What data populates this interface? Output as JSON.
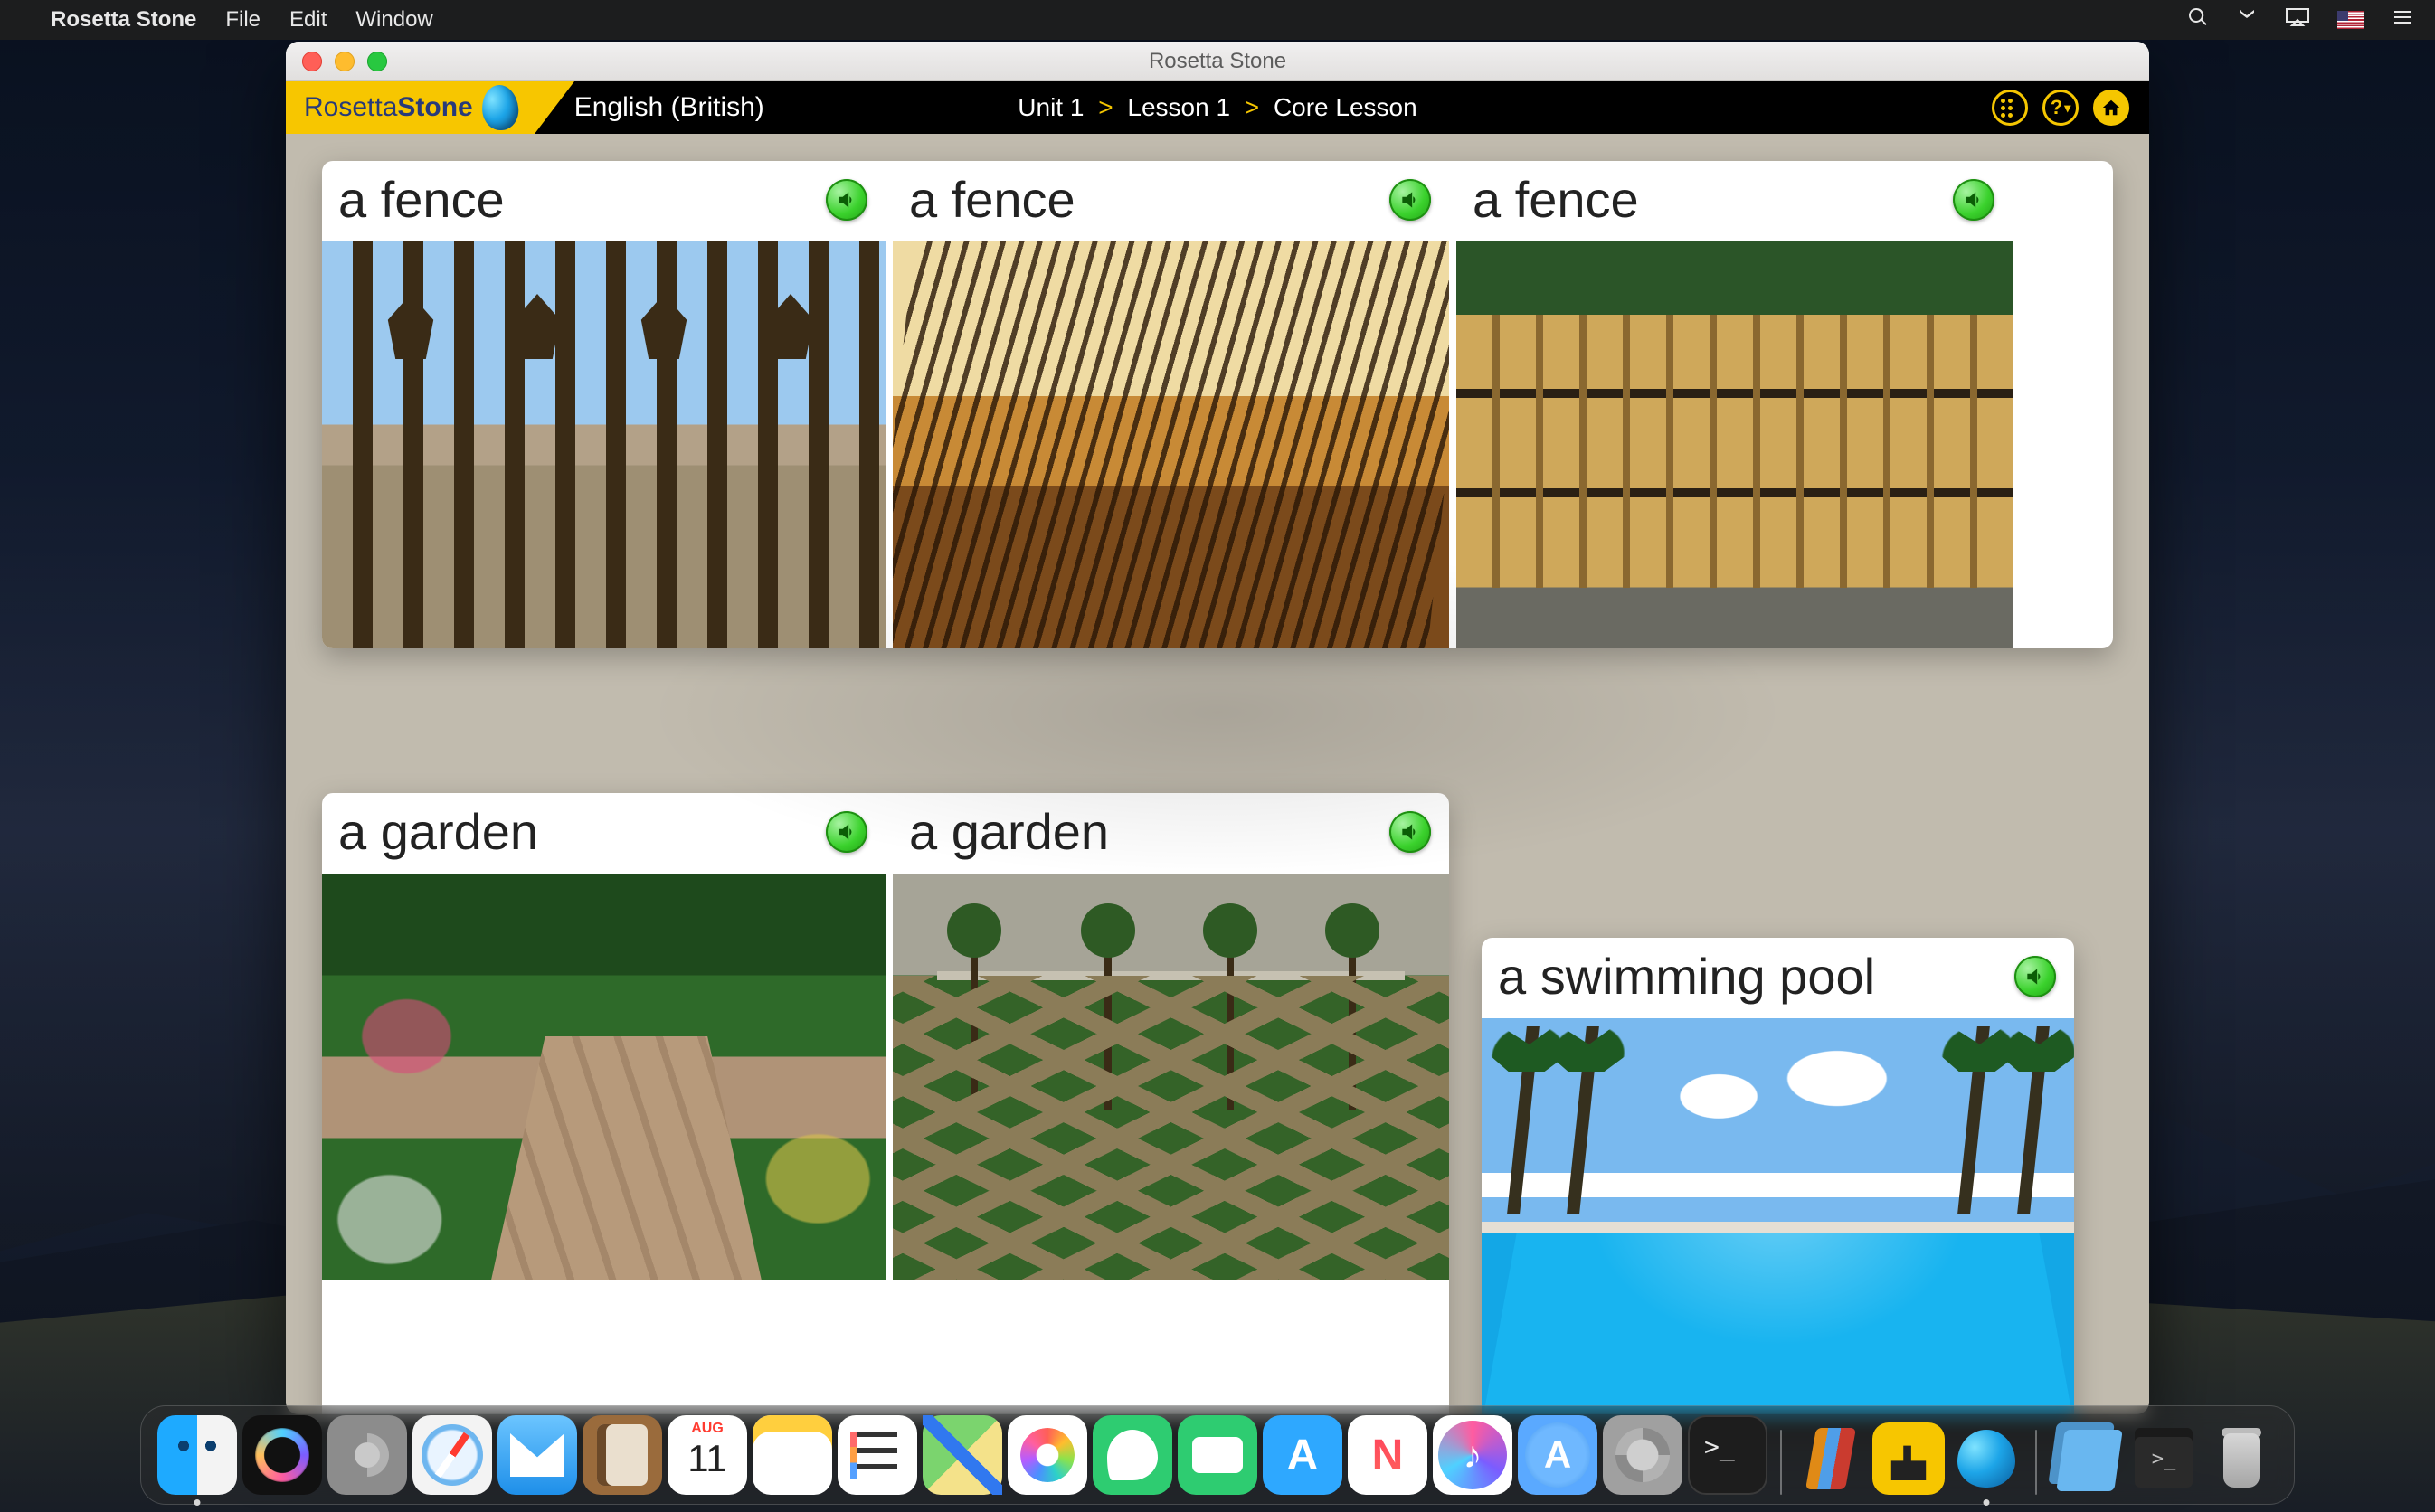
{
  "menubar": {
    "app_name": "Rosetta Stone",
    "items": [
      "File",
      "Edit",
      "Window"
    ]
  },
  "window": {
    "title": "Rosetta Stone",
    "logo_text_a": "Rosetta",
    "logo_text_b": "Stone",
    "language": "English (British)",
    "breadcrumb": {
      "unit": "Unit 1",
      "lesson": "Lesson 1",
      "section": "Core Lesson"
    }
  },
  "cards_row1": [
    {
      "label": "a fence"
    },
    {
      "label": "a fence"
    },
    {
      "label": "a fence"
    }
  ],
  "cards_row2a": [
    {
      "label": "a garden"
    },
    {
      "label": "a garden"
    }
  ],
  "cards_row2b": [
    {
      "label": "a swimming pool"
    }
  ],
  "dock": {
    "calendar_month": "AUG",
    "calendar_day": "11"
  }
}
